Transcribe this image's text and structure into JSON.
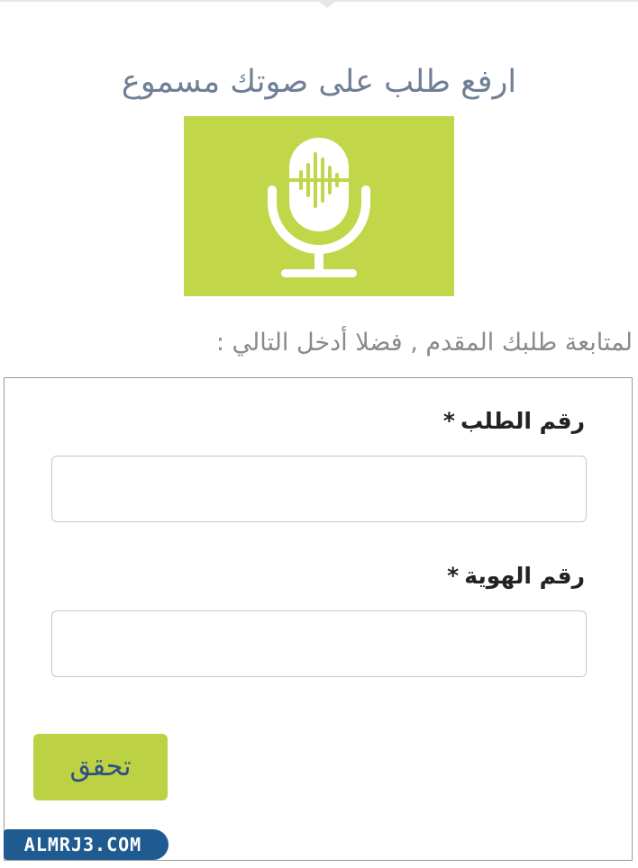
{
  "header": {
    "title": "ارفع طلب على صوتك مسموع"
  },
  "banner": {
    "icon": "microphone-icon",
    "background_color": "#c2d64a",
    "icon_color": "#ffffff"
  },
  "instructions": {
    "text": "لمتابعة طلبك المقدم , فضلا أدخل التالي :"
  },
  "form": {
    "fields": [
      {
        "label": "رقم الطلب",
        "required_mark": "*",
        "value": "",
        "placeholder": ""
      },
      {
        "label": "رقم الهوية",
        "required_mark": "*",
        "value": "",
        "placeholder": ""
      }
    ],
    "submit_label": "تحقق",
    "submit_color": "#bcd143",
    "submit_text_color": "#2e4f86"
  },
  "watermark": {
    "text": "ALMRJ3.COM",
    "background_color": "#1f5a91"
  }
}
